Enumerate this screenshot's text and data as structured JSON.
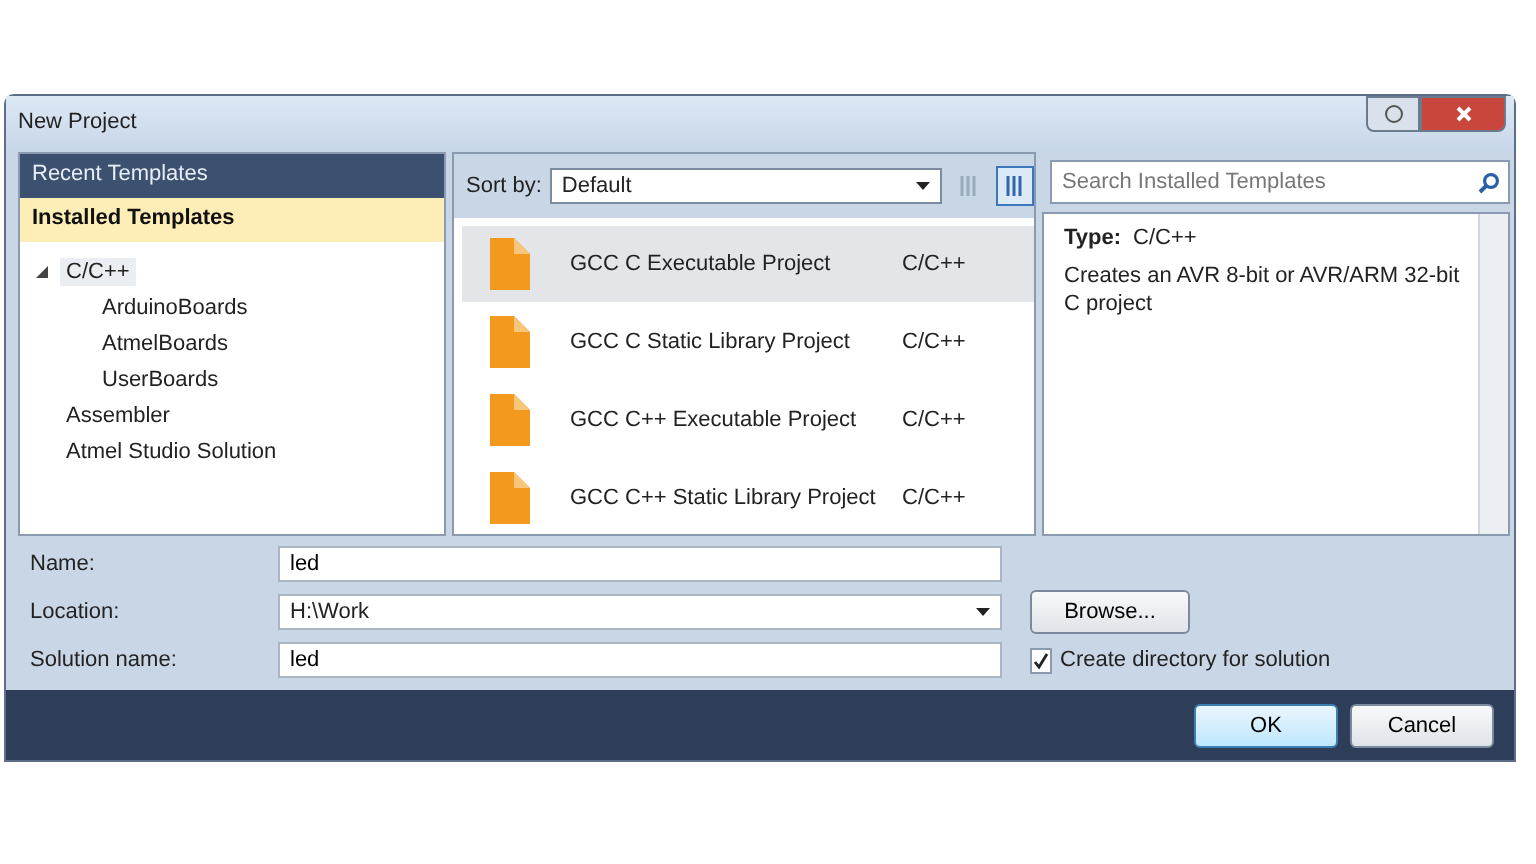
{
  "window": {
    "title": "New Project"
  },
  "sidebar": {
    "sections": [
      {
        "label": "Recent Templates",
        "selected": false
      },
      {
        "label": "Installed Templates",
        "selected": true
      }
    ],
    "tree": [
      {
        "label": "C/C++",
        "expanded": true,
        "selected": true,
        "children": [
          {
            "label": "ArduinoBoards"
          },
          {
            "label": "AtmelBoards"
          },
          {
            "label": "UserBoards"
          }
        ]
      },
      {
        "label": "Assembler",
        "selected": false
      },
      {
        "label": "Atmel Studio Solution",
        "selected": false
      }
    ]
  },
  "toolbar": {
    "sort_label": "Sort by:",
    "sort_value": "Default",
    "search": {
      "placeholder": "Search Installed Templates"
    }
  },
  "templates": [
    {
      "name": "GCC C Executable Project",
      "language": "C/C++",
      "selected": true
    },
    {
      "name": "GCC C Static Library Project",
      "language": "C/C++",
      "selected": false
    },
    {
      "name": "GCC C++ Executable Project",
      "language": "C/C++",
      "selected": false
    },
    {
      "name": "GCC C++ Static Library Project",
      "language": "C/C++",
      "selected": false
    }
  ],
  "details": {
    "type_label": "Type:",
    "type_value": "C/C++",
    "description": "Creates an AVR 8-bit or AVR/ARM 32-bit C project"
  },
  "form": {
    "name_label": "Name:",
    "name_value": "led",
    "location_label": "Location:",
    "location_value": "H:\\Work",
    "browse": "Browse...",
    "solution_label": "Solution name:",
    "solution_value": "led",
    "create_directory": {
      "label": "Create directory for solution",
      "checked": true
    }
  },
  "buttons": [
    "OK",
    "Cancel"
  ]
}
